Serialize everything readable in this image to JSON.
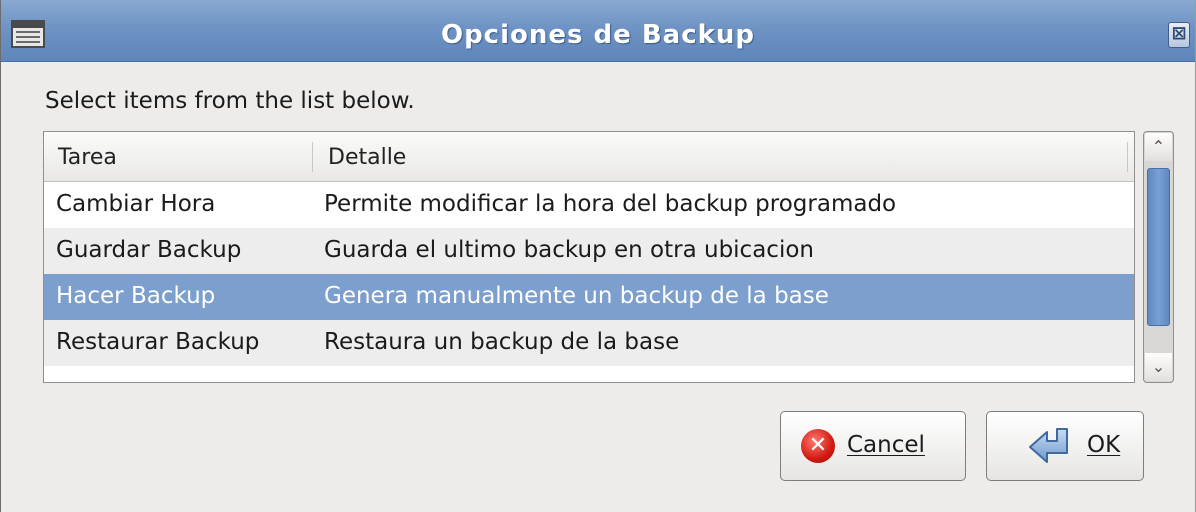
{
  "window": {
    "title": "Opciones de Backup",
    "close_glyph": "⊠"
  },
  "instruction": "Select items from the list below.",
  "list": {
    "columns": [
      "Tarea",
      "Detalle"
    ],
    "rows": [
      {
        "tarea": "Cambiar Hora",
        "detalle": "Permite modificar la hora del backup programado"
      },
      {
        "tarea": "Guardar Backup",
        "detalle": "Guarda el ultimo backup en otra ubicacion"
      },
      {
        "tarea": "Hacer Backup",
        "detalle": "Genera manualmente un backup de la base"
      },
      {
        "tarea": "Restaurar Backup",
        "detalle": "Restaura un backup de la base"
      }
    ],
    "selected_row": 2
  },
  "scrollbar": {
    "up_glyph": "⌃",
    "down_glyph": "⌄"
  },
  "buttons": {
    "cancel_label": "Cancel",
    "cancel_icon": "✕",
    "ok_label": "OK"
  },
  "icons": {
    "window_menu": "window-menu-icon",
    "close": "close-icon",
    "cancel": "cancel-icon",
    "ok": "ok-return-arrow-icon"
  },
  "colors": {
    "titlebar": "#6e93c4",
    "selection": "#7c9fce",
    "scroll_thumb": "#6a93cc",
    "background": "#edeceb"
  }
}
